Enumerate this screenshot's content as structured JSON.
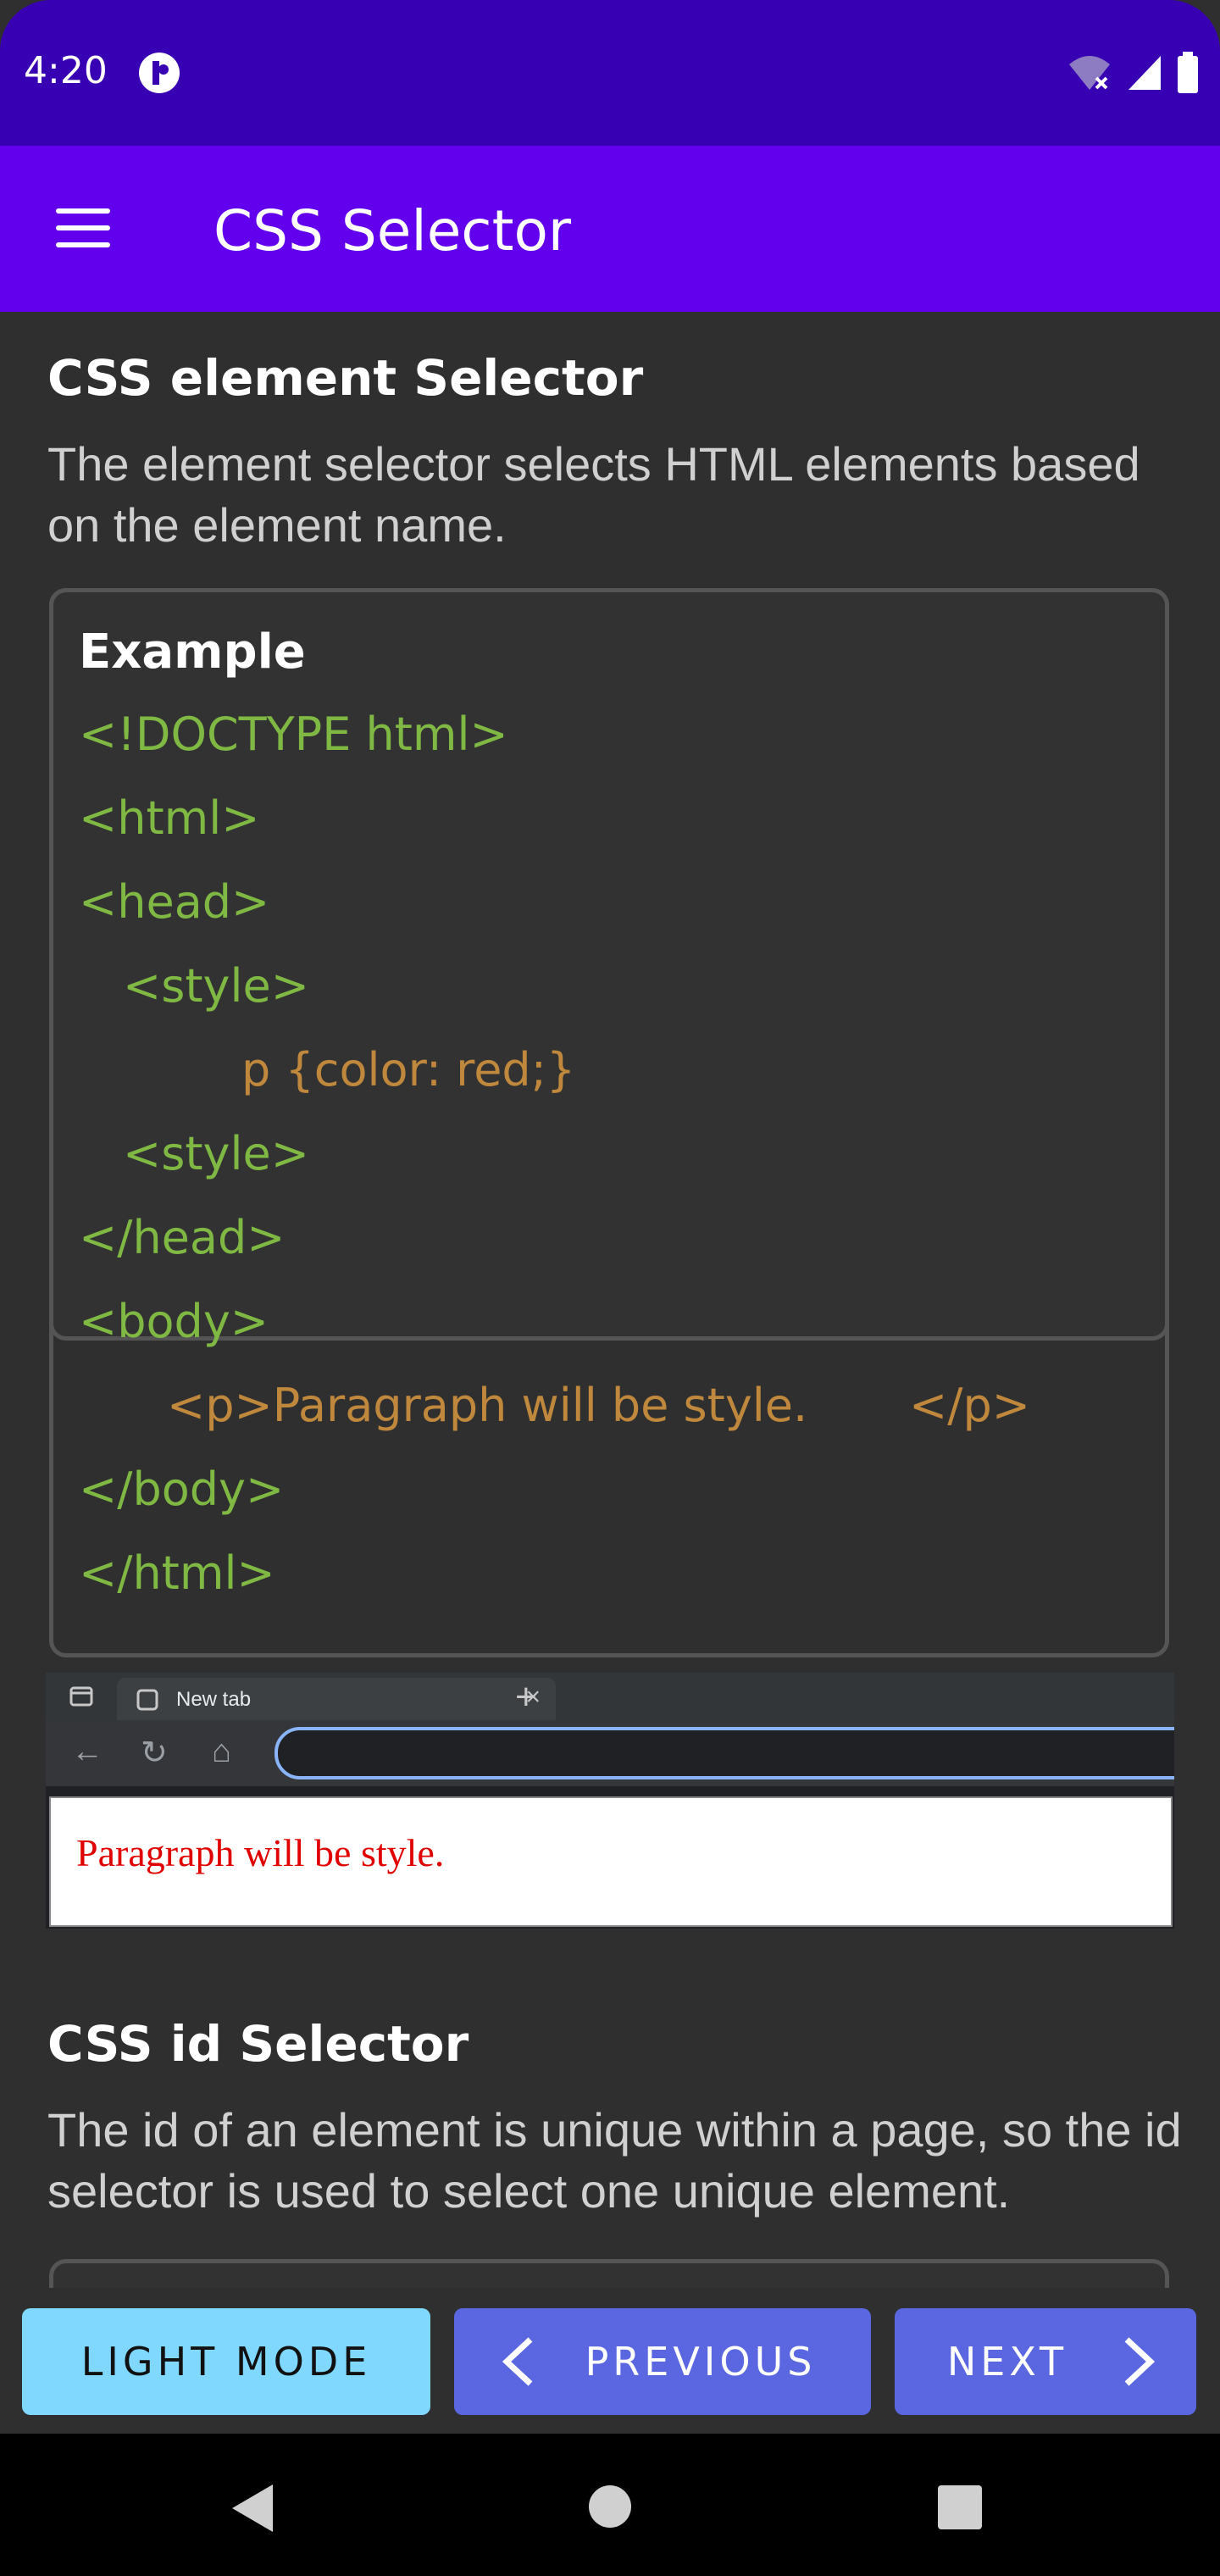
{
  "status_bar": {
    "time": "4:20"
  },
  "app_bar": {
    "title": "CSS Selector"
  },
  "section1": {
    "title": "CSS element Selector",
    "description": "The element selector selects HTML elements based on the element name.",
    "example_title": "Example",
    "code_lines": [
      "<!DOCTYPE html>",
      "<html>",
      "<head>",
      "<style>",
      "p {color: red;}",
      "<style>",
      "</head>",
      "<body>",
      "<p>Paragraph will be style.",
      "</p>",
      "</body>",
      "</html>"
    ]
  },
  "browser_preview": {
    "tab_label": "New tab",
    "paragraph": "Paragraph will be style."
  },
  "section2": {
    "title": "CSS id Selector",
    "description": "The id of an element is unique within a page, so the id selector is used to select one unique element."
  },
  "buttons": {
    "light_mode": "LIGHT MODE",
    "previous": "PREVIOUS",
    "next": "NEXT"
  },
  "colors": {
    "status_bar": "#3700b3",
    "app_bar": "#6200ee",
    "code_tag": "#7fb843",
    "code_value": "#c0883c",
    "light_button": "#80d8ff",
    "nav_button": "#5b67e0"
  }
}
